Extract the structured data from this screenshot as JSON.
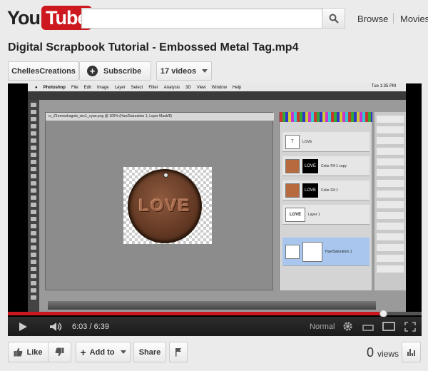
{
  "header": {
    "logo_you": "You",
    "logo_tube": "Tube",
    "search_placeholder": "",
    "nav": {
      "browse": "Browse",
      "movies": "Movies"
    }
  },
  "video": {
    "title": "Digital Scrapbook Tutorial - Embossed Metal Tag.mp4",
    "channel_name": "ChellesCreations",
    "subscribe_label": "Subscribe",
    "videos_count_label": "17 videos"
  },
  "screen": {
    "app_name": "Photoshop",
    "menu": [
      "File",
      "Edit",
      "Image",
      "Layer",
      "Select",
      "Filter",
      "Analysis",
      "3D",
      "View",
      "Window",
      "Help"
    ],
    "clock": "Tue 1:35 PM",
    "doc_tab": "cr_Z1mmsshagwb_circ1_cyan.png @ 100% (Hue/Saturation 1, Layer Mask/8)",
    "tag_text": "LOVE",
    "layers": [
      {
        "thumb": "T",
        "name": "LOVE"
      },
      {
        "thumb": "",
        "mask": "LOVE",
        "name": "Color Fill 1 copy"
      },
      {
        "thumb": "",
        "mask": "LOVE",
        "name": "Color Fill 1"
      },
      {
        "thumb": "LOVE",
        "name": "Layer 1"
      },
      {
        "thumb": "",
        "name": "Hue/Saturation 1"
      }
    ]
  },
  "player": {
    "current_time": "6:03",
    "duration": "6:39",
    "time_separator": "/",
    "progress_fraction": 0.909,
    "quality_label": "Normal",
    "accent_color": "#cc181e"
  },
  "actions": {
    "like_label": "Like",
    "add_to_label": "Add to",
    "share_label": "Share",
    "view_count": "0",
    "views_label": "views"
  }
}
